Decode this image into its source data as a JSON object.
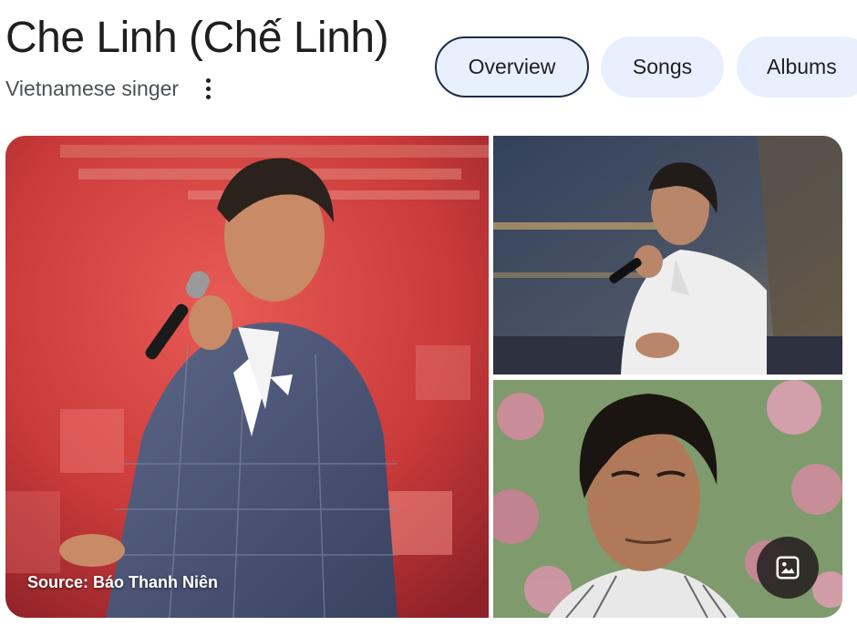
{
  "entity": {
    "title": "Che Linh (Chế Linh)",
    "subtitle": "Vietnamese singer"
  },
  "more_options_icon": "three-dots-vertical-icon",
  "tabs": [
    {
      "label": "Overview",
      "selected": true
    },
    {
      "label": "Songs",
      "selected": false
    },
    {
      "label": "Albums",
      "selected": false
    }
  ],
  "gallery": {
    "source_text": "Source: Báo Thanh Niên",
    "view_images_icon": "image-icon"
  },
  "colors": {
    "tab_background": "#e8f0fe",
    "tab_selected_border": "#1f2d4a",
    "text_primary": "#1f1f1f",
    "text_secondary": "#4d5156",
    "stage_red": "#c8393a"
  }
}
